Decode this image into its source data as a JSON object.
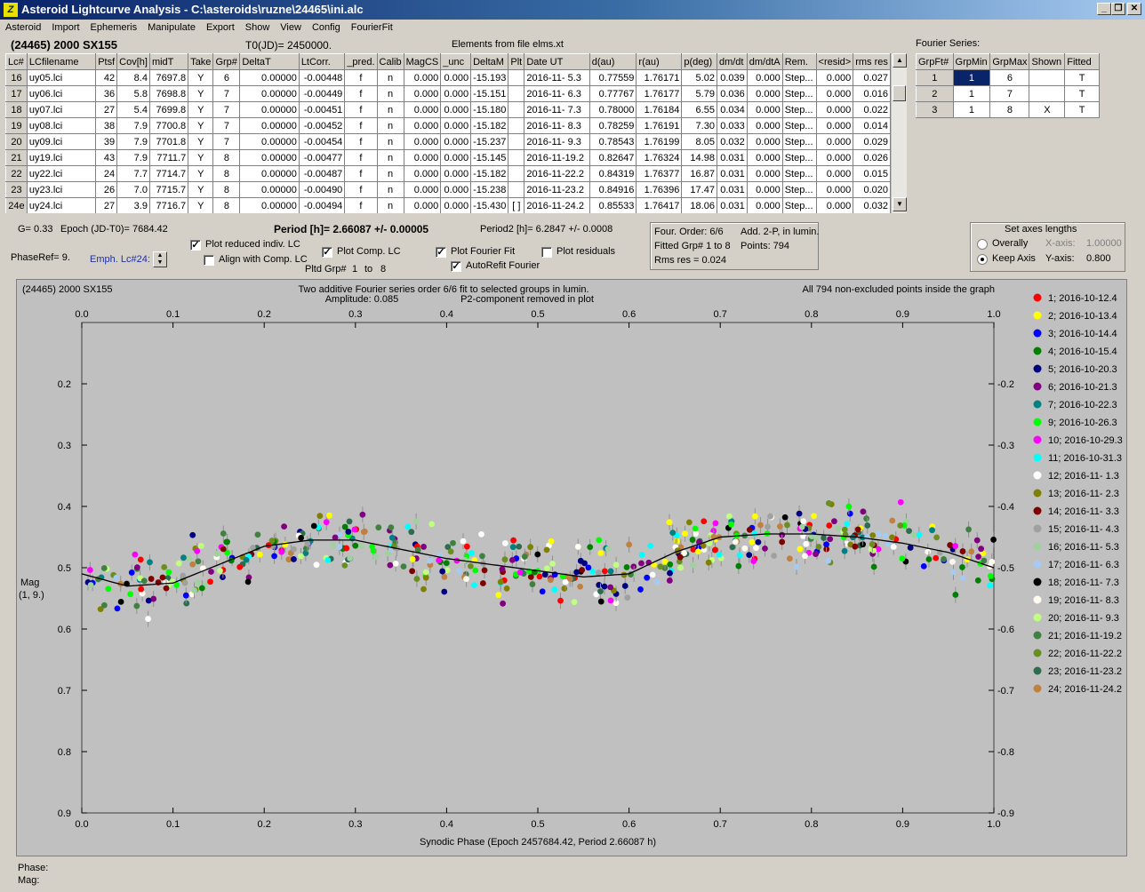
{
  "window": {
    "title": "Asteroid Lightcurve Analysis - C:\\asteroids\\ruzne\\24465\\ini.alc",
    "icon_glyph": "Z"
  },
  "window_controls": {
    "minimize": "_",
    "restore": "❐",
    "close": "✕"
  },
  "menu": [
    "Asteroid",
    "Import",
    "Ephemeris",
    "Manipulate",
    "Export",
    "Show",
    "View",
    "Config",
    "FourierFit"
  ],
  "header": {
    "asteroid": "(24465) 2000 SX155",
    "t0": "T0(JD)= 2450000.",
    "elements": "Elements from file elms.xt",
    "fourier_title": "Fourier Series:"
  },
  "lc_table": {
    "columns": [
      "Lc#",
      "LCfilename",
      "Ptsf",
      "Cov[h]",
      "midT",
      "Take",
      "Grp#",
      "DeltaT",
      "LtCorr.",
      "_pred.",
      "Calib",
      "MagCS",
      "_unc",
      "DeltaM",
      "Plt",
      "Date UT",
      "d(au)",
      "r(au)",
      "p(deg)",
      "dm/dt",
      "dm/dtA",
      "Rem.",
      "<resid>",
      "rms res"
    ],
    "rows": [
      [
        "16",
        "uy05.lci",
        "42",
        "8.4",
        "7697.8",
        "Y",
        "6",
        "0.00000",
        "-0.00448",
        "f",
        "n",
        "0.000",
        "0.000",
        "-15.193",
        "",
        "2016-11- 5.3",
        "0.77559",
        "1.76171",
        "5.02",
        "0.039",
        "0.000",
        "Step...",
        "0.000",
        "0.027"
      ],
      [
        "17",
        "uy06.lci",
        "36",
        "5.8",
        "7698.8",
        "Y",
        "7",
        "0.00000",
        "-0.00449",
        "f",
        "n",
        "0.000",
        "0.000",
        "-15.151",
        "",
        "2016-11- 6.3",
        "0.77767",
        "1.76177",
        "5.79",
        "0.036",
        "0.000",
        "Step...",
        "0.000",
        "0.016"
      ],
      [
        "18",
        "uy07.lci",
        "27",
        "5.4",
        "7699.8",
        "Y",
        "7",
        "0.00000",
        "-0.00451",
        "f",
        "n",
        "0.000",
        "0.000",
        "-15.180",
        "",
        "2016-11- 7.3",
        "0.78000",
        "1.76184",
        "6.55",
        "0.034",
        "0.000",
        "Step...",
        "0.000",
        "0.022"
      ],
      [
        "19",
        "uy08.lci",
        "38",
        "7.9",
        "7700.8",
        "Y",
        "7",
        "0.00000",
        "-0.00452",
        "f",
        "n",
        "0.000",
        "0.000",
        "-15.182",
        "",
        "2016-11- 8.3",
        "0.78259",
        "1.76191",
        "7.30",
        "0.033",
        "0.000",
        "Step...",
        "0.000",
        "0.014"
      ],
      [
        "20",
        "uy09.lci",
        "39",
        "7.9",
        "7701.8",
        "Y",
        "7",
        "0.00000",
        "-0.00454",
        "f",
        "n",
        "0.000",
        "0.000",
        "-15.237",
        "",
        "2016-11- 9.3",
        "0.78543",
        "1.76199",
        "8.05",
        "0.032",
        "0.000",
        "Step...",
        "0.000",
        "0.029"
      ],
      [
        "21",
        "uy19.lci",
        "43",
        "7.9",
        "7711.7",
        "Y",
        "8",
        "0.00000",
        "-0.00477",
        "f",
        "n",
        "0.000",
        "0.000",
        "-15.145",
        "",
        "2016-11-19.2",
        "0.82647",
        "1.76324",
        "14.98",
        "0.031",
        "0.000",
        "Step...",
        "0.000",
        "0.026"
      ],
      [
        "22",
        "uy22.lci",
        "24",
        "7.7",
        "7714.7",
        "Y",
        "8",
        "0.00000",
        "-0.00487",
        "f",
        "n",
        "0.000",
        "0.000",
        "-15.182",
        "",
        "2016-11-22.2",
        "0.84319",
        "1.76377",
        "16.87",
        "0.031",
        "0.000",
        "Step...",
        "0.000",
        "0.015"
      ],
      [
        "23",
        "uy23.lci",
        "26",
        "7.0",
        "7715.7",
        "Y",
        "8",
        "0.00000",
        "-0.00490",
        "f",
        "n",
        "0.000",
        "0.000",
        "-15.238",
        "",
        "2016-11-23.2",
        "0.84916",
        "1.76396",
        "17.47",
        "0.031",
        "0.000",
        "Step...",
        "0.000",
        "0.020"
      ],
      [
        "24e",
        "uy24.lci",
        "27",
        "3.9",
        "7716.7",
        "Y",
        "8",
        "0.00000",
        "-0.00494",
        "f",
        "n",
        "0.000",
        "0.000",
        "-15.430",
        "[ ]",
        "2016-11-24.2",
        "0.85533",
        "1.76417",
        "18.06",
        "0.031",
        "0.000",
        "Step...",
        "0.000",
        "0.032"
      ]
    ]
  },
  "fourier_table": {
    "columns": [
      "GrpFt#",
      "GrpMin",
      "GrpMax",
      "Shown",
      "Fitted"
    ],
    "rows": [
      [
        "1",
        "1",
        "6",
        "",
        "T"
      ],
      [
        "2",
        "1",
        "7",
        "",
        "T"
      ],
      [
        "3",
        "1",
        "8",
        "X",
        "T"
      ]
    ]
  },
  "info": {
    "g": "G= 0.33",
    "epoch": "Epoch (JD-T0)= 7684.42",
    "period": "Period [h]= 2.66087 +/- 0.00005",
    "period2": "Period2 [h]= 6.2847 +/- 0.0008",
    "phaseref": "PhaseRef= 9.",
    "emph": "Emph. Lc#24:",
    "pltd_grp": "Pltd Grp#",
    "pltd_from": "1",
    "pltd_to_label": "to",
    "pltd_to": "8"
  },
  "checks": [
    {
      "label": "Plot reduced indiv. LC",
      "checked": true
    },
    {
      "label": "Align with Comp. LC",
      "checked": false
    },
    {
      "label": "Plot Comp. LC",
      "checked": true
    },
    {
      "label": "Plot Fourier Fit",
      "checked": true
    },
    {
      "label": "AutoRefit Fourier",
      "checked": true
    },
    {
      "label": "Plot residuals",
      "checked": false
    }
  ],
  "fit_info": {
    "order": "Four. Order: 6/6",
    "add": "Add. 2-P, in lumin.",
    "fitted": "Fitted Grp# 1 to 8",
    "points": "Points: 794",
    "rms": "Rms res     = 0.024"
  },
  "axes": {
    "title": "Set axes lengths",
    "overally": "Overally",
    "keep": "Keep Axis",
    "xaxis_label": "X-axis:",
    "xaxis_value": "1.00000",
    "yaxis_label": "Y-axis:",
    "yaxis_value": "0.800"
  },
  "plot": {
    "corner": "(24465) 2000 SX155",
    "line1": "Two additive Fourier series order 6/6 fit to selected groups in lumin.",
    "amp": "Amplitude: 0.085",
    "p2": "P2-component removed in plot",
    "allpts": "All 794 non-excluded points inside the graph",
    "ylabel1": "Mag",
    "ylabel2": "(1, 9.)",
    "xlabel": "Synodic Phase (Epoch 2457684.42, Period 2.66087 h)"
  },
  "chart_data": {
    "type": "scatter",
    "xlim": [
      0.0,
      1.0
    ],
    "ylim": [
      0.9,
      0.1
    ],
    "x_ticks": [
      "0.0",
      "0.1",
      "0.2",
      "0.3",
      "0.4",
      "0.5",
      "0.6",
      "0.7",
      "0.8",
      "0.9",
      "1.0"
    ],
    "y_ticks": [
      "0.2",
      "0.3",
      "0.4",
      "0.5",
      "0.6",
      "0.7",
      "0.8",
      "0.9"
    ],
    "fit_curve": {
      "phase": [
        0.0,
        0.05,
        0.1,
        0.15,
        0.2,
        0.25,
        0.3,
        0.35,
        0.4,
        0.45,
        0.5,
        0.55,
        0.6,
        0.65,
        0.7,
        0.75,
        0.8,
        0.85,
        0.9,
        0.95,
        1.0
      ],
      "mag": [
        0.51,
        0.53,
        0.525,
        0.495,
        0.465,
        0.455,
        0.455,
        0.47,
        0.485,
        0.495,
        0.505,
        0.515,
        0.51,
        0.475,
        0.45,
        0.445,
        0.445,
        0.45,
        0.46,
        0.475,
        0.5
      ]
    },
    "legend": [
      {
        "label": "1; 2016-10-12.4",
        "color": "#ff0000"
      },
      {
        "label": "2; 2016-10-13.4",
        "color": "#ffff00"
      },
      {
        "label": "3; 2016-10-14.4",
        "color": "#0000ff"
      },
      {
        "label": "4; 2016-10-15.4",
        "color": "#008000"
      },
      {
        "label": "5; 2016-10-20.3",
        "color": "#000080"
      },
      {
        "label": "6; 2016-10-21.3",
        "color": "#800080"
      },
      {
        "label": "7; 2016-10-22.3",
        "color": "#008080"
      },
      {
        "label": "9; 2016-10-26.3",
        "color": "#00ff00"
      },
      {
        "label": "10; 2016-10-29.3",
        "color": "#ff00ff"
      },
      {
        "label": "11; 2016-10-31.3",
        "color": "#00ffff"
      },
      {
        "label": "12; 2016-11- 1.3",
        "color": "#ffffff"
      },
      {
        "label": "13; 2016-11- 2.3",
        "color": "#808000"
      },
      {
        "label": "14; 2016-11- 3.3",
        "color": "#800000"
      },
      {
        "label": "15; 2016-11- 4.3",
        "color": "#a0a0a0"
      },
      {
        "label": "16; 2016-11- 5.3",
        "color": "#a0d0a0"
      },
      {
        "label": "17; 2016-11- 6.3",
        "color": "#a6caf0"
      },
      {
        "label": "18; 2016-11- 7.3",
        "color": "#000000"
      },
      {
        "label": "19; 2016-11- 8.3",
        "color": "#fffbf0"
      },
      {
        "label": "20; 2016-11- 9.3",
        "color": "#c0ff80"
      },
      {
        "label": "21; 2016-11-19.2",
        "color": "#408040"
      },
      {
        "label": "22; 2016-11-22.2",
        "color": "#6b8e23"
      },
      {
        "label": "23; 2016-11-23.2",
        "color": "#2e6b4f"
      },
      {
        "label": "24; 2016-11-24.2",
        "color": "#c08040"
      }
    ]
  },
  "status": {
    "phase": "Phase:",
    "mag": "Mag:"
  }
}
